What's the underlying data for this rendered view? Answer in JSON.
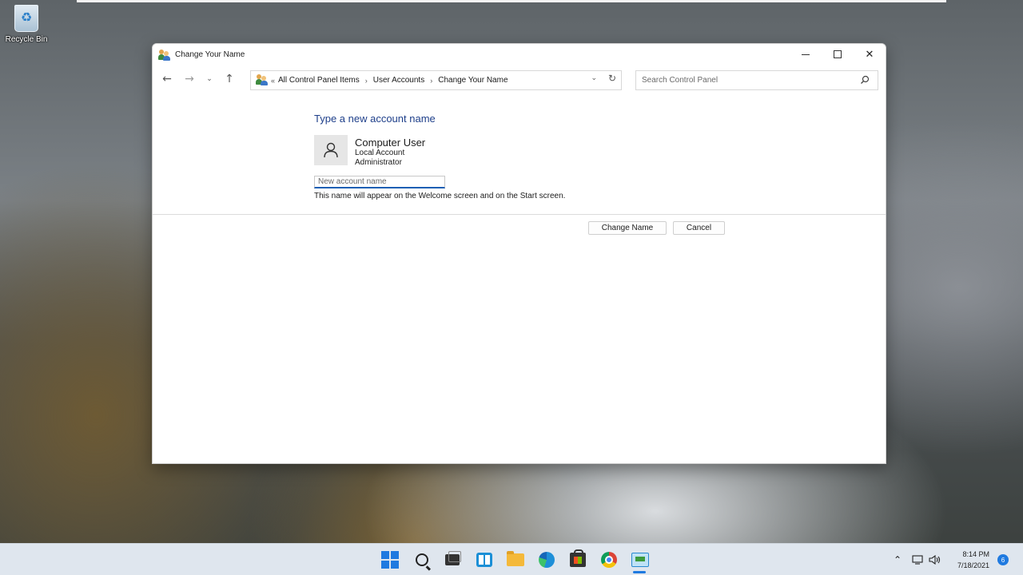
{
  "desktop": {
    "recycle_bin_label": "Recycle Bin"
  },
  "window": {
    "title": "Change Your Name",
    "controls": {
      "minimize": "minimize-icon",
      "maximize": "maximize-icon",
      "close": "close-icon"
    }
  },
  "address": {
    "lead": "«",
    "crumbs": [
      "All Control Panel Items",
      "User Accounts",
      "Change Your Name"
    ],
    "separator": "›"
  },
  "search": {
    "placeholder": "Search Control Panel"
  },
  "content": {
    "heading": "Type a new account name",
    "user_name": "Computer User",
    "account_type": "Local Account",
    "account_role": "Administrator",
    "input_placeholder": "New account name",
    "input_value": "",
    "hint": "This name will appear on the Welcome screen and on the Start screen.",
    "change_button": "Change Name",
    "cancel_button": "Cancel"
  },
  "taskbar": {
    "time": "8:14 PM",
    "date": "7/18/2021",
    "notifications": "6"
  },
  "colors": {
    "accent": "#1f7ae0",
    "heading": "#1e3f8a"
  }
}
